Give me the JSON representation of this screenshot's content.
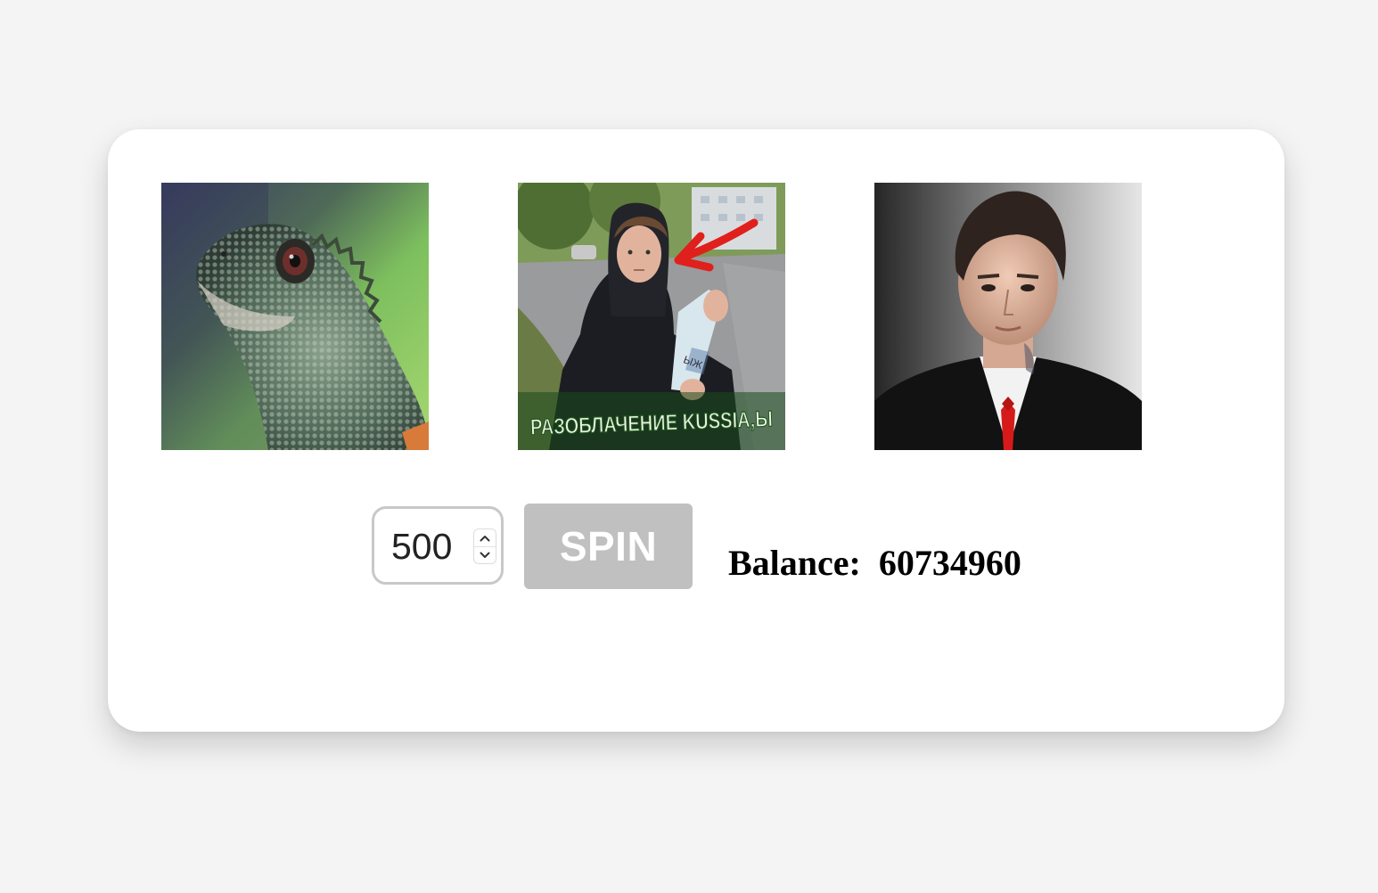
{
  "reels": [
    {
      "symbol": "lizard-photo"
    },
    {
      "symbol": "hooded-person-bottle-photo",
      "caption": "РАЗОБЛАЧЕНИЕ KUSSIA,Ы",
      "bottle_label": "ЫЖ"
    },
    {
      "symbol": "man-in-suit-photo"
    }
  ],
  "controls": {
    "bet_value": "500",
    "spin_label": "SPIN",
    "balance_label": "Balance:",
    "balance_value": "60734960"
  },
  "colors": {
    "page_background": "#f4f4f4",
    "card_background": "#ffffff",
    "spin_button_disabled": "#c0c0c0",
    "input_border": "#c8c8c8"
  }
}
